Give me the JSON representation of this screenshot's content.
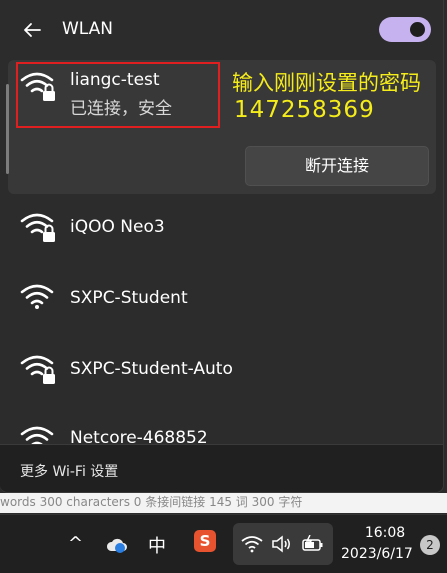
{
  "header": {
    "title": "WLAN",
    "toggle_on": true
  },
  "connected_network": {
    "name": "liangc-test",
    "status": "已连接，安全",
    "disconnect_label": "断开连接"
  },
  "annotation": {
    "line1": "输入刚刚设置的密码",
    "line2": "147258369"
  },
  "networks": [
    {
      "name": "iQOO Neo3",
      "secured": true
    },
    {
      "name": "SXPC-Student",
      "secured": false
    },
    {
      "name": "SXPC-Student-Auto",
      "secured": true
    },
    {
      "name": "Netcore-468852",
      "secured": true
    }
  ],
  "footer": {
    "more_label": "更多 Wi-Fi 设置"
  },
  "background_strip": "words 300 characters   0 条接间链接   145   词 300   字符   ",
  "taskbar": {
    "chevron": "^",
    "ime": "中",
    "sogou": "S",
    "time": "16:08",
    "date": "2023/6/17",
    "notifications": "2"
  },
  "colors": {
    "accent_toggle": "#c6b2ef",
    "annotation": "#f5ec1b",
    "highlight_box": "#e02020"
  }
}
